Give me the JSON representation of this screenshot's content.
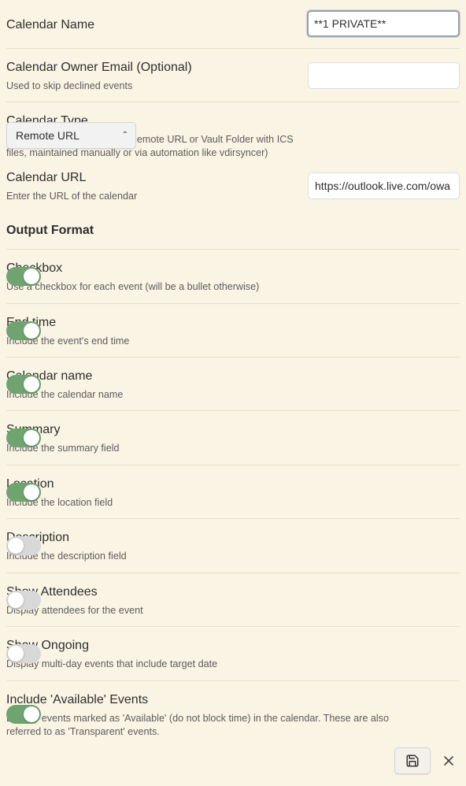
{
  "calendar_name": {
    "label": "Calendar Name",
    "value": "**1 PRIVATE**"
  },
  "owner_email": {
    "label": "Calendar Owner Email (Optional)",
    "desc": "Used to skip declined events",
    "value": ""
  },
  "calendar_type": {
    "label": "Calendar Type",
    "desc": "Select the type of calendar (Remote URL or Vault Folder with ICS files, maintained manually or via automation like vdirsyncer)",
    "selected": "Remote URL"
  },
  "calendar_url": {
    "label": "Calendar URL",
    "desc": "Enter the URL of the calendar",
    "value": "https://outlook.live.com/owa"
  },
  "output_format": {
    "heading": "Output Format"
  },
  "toggles": [
    {
      "label": "Checkbox",
      "desc": "Use a checkbox for each event (will be a bullet otherwise)",
      "on": true
    },
    {
      "label": "End time",
      "desc": "Include the event's end time",
      "on": true
    },
    {
      "label": "Calendar name",
      "desc": "Include the calendar name",
      "on": true
    },
    {
      "label": "Summary",
      "desc": "Include the summary field",
      "on": true
    },
    {
      "label": "Location",
      "desc": "Include the location field",
      "on": true
    },
    {
      "label": "Description",
      "desc": "Include the description field",
      "on": false
    },
    {
      "label": "Show Attendees",
      "desc": "Display attendees for the event",
      "on": false
    },
    {
      "label": "Show Ongoing",
      "desc": "Display multi-day events that include target date",
      "on": false
    },
    {
      "label": "Include 'Available' Events",
      "desc": "Display events marked as 'Available' (do not block time) in the calendar. These are also referred to as 'Transparent' events.",
      "on": true
    }
  ],
  "actions": {
    "save_icon": "save-icon",
    "close_icon": "close-icon"
  },
  "colors": {
    "background": "#faf4e4",
    "toggle_on": "#6fa36f",
    "toggle_off": "#d8d8d8"
  }
}
